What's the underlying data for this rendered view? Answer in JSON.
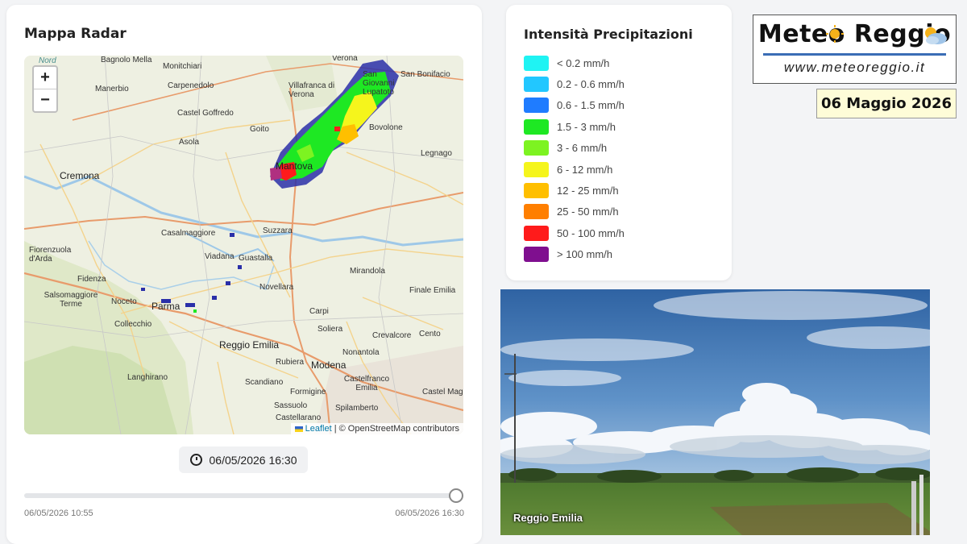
{
  "radar": {
    "title": "Mappa Radar",
    "zoom_in": "+",
    "zoom_out": "−",
    "attribution_link": "Leaflet",
    "attribution_text": " | © OpenStreetMap contributors",
    "current_time": "06/05/2026 16:30",
    "slider_start": "06/05/2026 10:55",
    "slider_end": "06/05/2026 16:30",
    "slider_position": 1.0,
    "towns": [
      {
        "name": "Nord"
      },
      {
        "name": "Bagnolo Mella"
      },
      {
        "name": "Monitchiari"
      },
      {
        "name": "Verona"
      },
      {
        "name": "San Bonifacio"
      },
      {
        "name": "Manerbio"
      },
      {
        "name": "Carpenedolo"
      },
      {
        "name": "Villafranca di Verona"
      },
      {
        "name": "San Giovanni Lupatoto"
      },
      {
        "name": "Castel Goffredo"
      },
      {
        "name": "Goito"
      },
      {
        "name": "Bovolone"
      },
      {
        "name": "Asola"
      },
      {
        "name": "Legnago"
      },
      {
        "name": "Cremona"
      },
      {
        "name": "Mantova"
      },
      {
        "name": "Suzzara"
      },
      {
        "name": "Casalmaggiore"
      },
      {
        "name": "Fiorenzuola d'Arda"
      },
      {
        "name": "Viadana"
      },
      {
        "name": "Guastalla"
      },
      {
        "name": "Mirandola"
      },
      {
        "name": "Fidenza"
      },
      {
        "name": "Novellara"
      },
      {
        "name": "Finale Emilia"
      },
      {
        "name": "Salsomaggiore Terme"
      },
      {
        "name": "Noceto"
      },
      {
        "name": "Parma"
      },
      {
        "name": "Carpi"
      },
      {
        "name": "Collecchio"
      },
      {
        "name": "Soliera"
      },
      {
        "name": "Crevalcore"
      },
      {
        "name": "Cento"
      },
      {
        "name": "Reggio Emilia"
      },
      {
        "name": "Nonantola"
      },
      {
        "name": "Rubiera"
      },
      {
        "name": "Modena"
      },
      {
        "name": "Langhirano"
      },
      {
        "name": "Castelfranco Emilia"
      },
      {
        "name": "Scandiano"
      },
      {
        "name": "Formigine"
      },
      {
        "name": "Castel Maggiore"
      },
      {
        "name": "Sassuolo"
      },
      {
        "name": "Spilamberto"
      },
      {
        "name": "Castellarano"
      }
    ]
  },
  "legend": {
    "title": "Intensità Precipitazioni",
    "items": [
      {
        "label": "< 0.2 mm/h",
        "color": "#1ff3f3"
      },
      {
        "label": "0.2 - 0.6 mm/h",
        "color": "#22c7ff"
      },
      {
        "label": "0.6 - 1.5 mm/h",
        "color": "#1f7cff"
      },
      {
        "label": "1.5 - 3 mm/h",
        "color": "#1ee823"
      },
      {
        "label": "3 - 6 mm/h",
        "color": "#7df321"
      },
      {
        "label": "6 - 12 mm/h",
        "color": "#f5f51c"
      },
      {
        "label": "12 - 25 mm/h",
        "color": "#ffbf00"
      },
      {
        "label": "25 - 50 mm/h",
        "color": "#ff7f00"
      },
      {
        "label": "50 - 100 mm/h",
        "color": "#ff1b1b"
      },
      {
        "label": "> 100 mm/h",
        "color": "#7f0f8f"
      }
    ]
  },
  "logo": {
    "title": "Meteo Reggio",
    "url": "www.meteoreggio.it"
  },
  "date": "06 Maggio 2026",
  "photo": {
    "caption": "Reggio Emilia"
  }
}
